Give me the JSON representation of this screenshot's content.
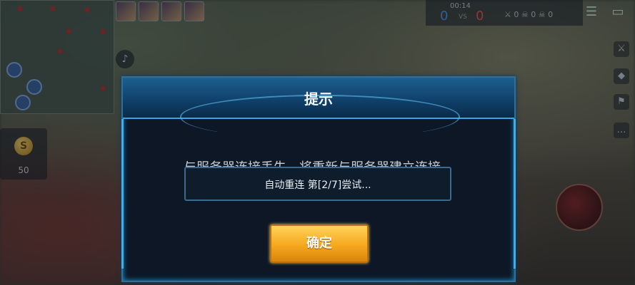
{
  "hud": {
    "timer": "00:14",
    "vs_label": "VS",
    "blue_kills": "0",
    "red_kills": "0",
    "kills": "0",
    "deaths": "0",
    "assists": "0",
    "gold_amount": "50",
    "gold_symbol": "S"
  },
  "dialog": {
    "title": "提示",
    "message": "与服务器连接丢失，将重新与服务器建立连接。",
    "reconnect_status": "自动重连 第[2/7]尝试...",
    "confirm_label": "确定"
  },
  "colors": {
    "accent_blue": "#38a6e0",
    "button_gold": "#f5a81e",
    "team_blue": "#4fa3ff",
    "team_red": "#ff5a52"
  }
}
